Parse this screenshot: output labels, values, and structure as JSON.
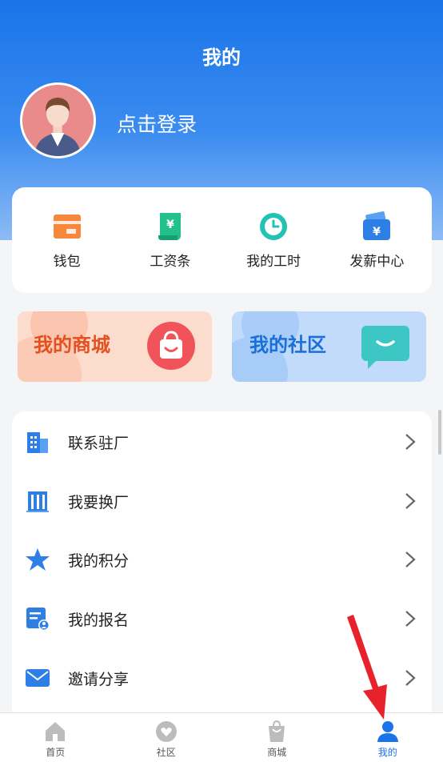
{
  "header": {
    "title": "我的",
    "login_text": "点击登录"
  },
  "quick_actions": [
    {
      "label": "钱包",
      "icon": "wallet-icon"
    },
    {
      "label": "工资条",
      "icon": "payslip-icon"
    },
    {
      "label": "我的工时",
      "icon": "clock-icon"
    },
    {
      "label": "发薪中心",
      "icon": "salary-center-icon"
    }
  ],
  "promos": {
    "shop": "我的商城",
    "community": "我的社区"
  },
  "menu": [
    {
      "label": "联系驻厂",
      "icon": "building-icon"
    },
    {
      "label": "我要换厂",
      "icon": "factory-icon"
    },
    {
      "label": "我的积分",
      "icon": "star-icon"
    },
    {
      "label": "我的报名",
      "icon": "signup-icon"
    },
    {
      "label": "邀请分享",
      "icon": "mail-icon"
    }
  ],
  "tabs": [
    {
      "label": "首页",
      "icon": "home-icon"
    },
    {
      "label": "社区",
      "icon": "heart-bubble-icon"
    },
    {
      "label": "商城",
      "icon": "bag-icon"
    },
    {
      "label": "我的",
      "icon": "person-icon",
      "active": true
    }
  ],
  "colors": {
    "primary": "#1a73e8",
    "shop_accent": "#e4501f",
    "community_accent": "#1b6fd9"
  }
}
